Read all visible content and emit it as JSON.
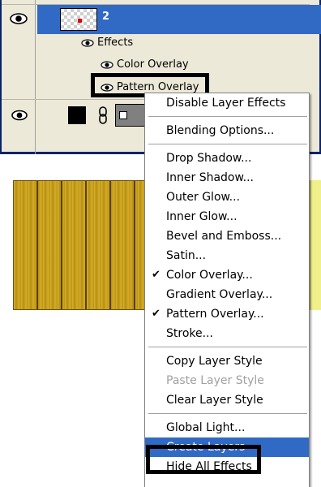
{
  "layers_panel": {
    "layer_name": "2",
    "effects_label": "Effects",
    "effect_items": [
      "Color Overlay",
      "Pattern Overlay"
    ]
  },
  "context_menu": {
    "groups": [
      [
        {
          "label": "Disable Layer Effects"
        }
      ],
      [
        {
          "label": "Blending Options..."
        }
      ],
      [
        {
          "label": "Drop Shadow..."
        },
        {
          "label": "Inner Shadow..."
        },
        {
          "label": "Outer Glow..."
        },
        {
          "label": "Inner Glow..."
        },
        {
          "label": "Bevel and Emboss..."
        },
        {
          "label": "Satin..."
        },
        {
          "label": "Color Overlay...",
          "checked": true
        },
        {
          "label": "Gradient Overlay..."
        },
        {
          "label": "Pattern Overlay...",
          "checked": true
        },
        {
          "label": "Stroke..."
        }
      ],
      [
        {
          "label": "Copy Layer Style"
        },
        {
          "label": "Paste Layer Style",
          "disabled": true
        },
        {
          "label": "Clear Layer Style"
        }
      ],
      [
        {
          "label": "Global Light..."
        },
        {
          "label": "Create Layers",
          "selected": true
        },
        {
          "label": "Hide All Effects"
        }
      ]
    ],
    "check_glyph": "✔"
  },
  "colors": {
    "selection": "#316ac5",
    "panel": "#ece9d8",
    "wood": "#c9a017"
  },
  "icons": [
    "eye-icon",
    "link-icon",
    "checkmark-icon"
  ]
}
